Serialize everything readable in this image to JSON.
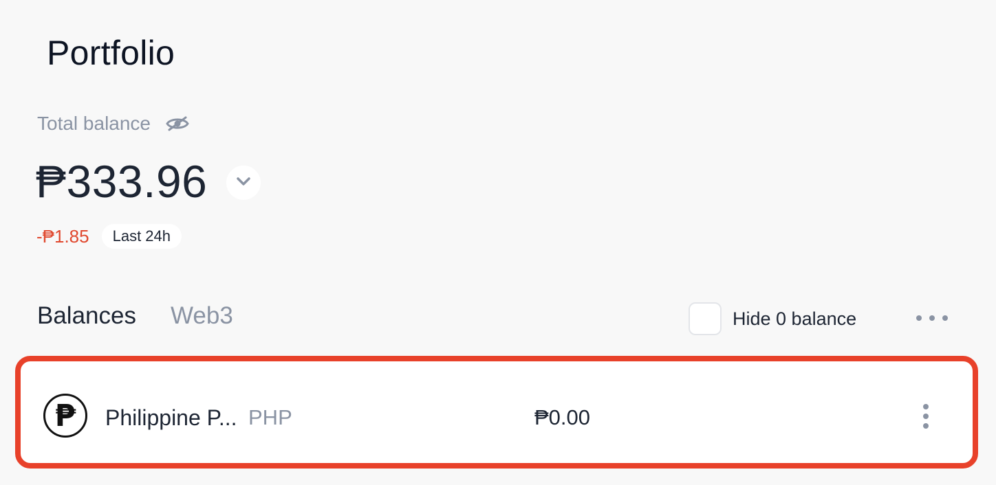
{
  "page": {
    "title": "Portfolio"
  },
  "summary": {
    "total_label": "Total balance",
    "visibility_icon": "eye-hidden-icon",
    "balance": "₱333.96",
    "currency_toggle_icon": "chevron-down-icon",
    "change_value": "-₱1.85",
    "change_period": "Last 24h"
  },
  "tabs": [
    {
      "label": "Balances",
      "active": true
    },
    {
      "label": "Web3",
      "active": false
    }
  ],
  "filters": {
    "hide_zero_label": "Hide 0 balance",
    "hide_zero_checked": false,
    "more_icon": "more-horizontal-icon"
  },
  "assets": [
    {
      "icon_glyph": "₱",
      "name": "Philippine P...",
      "code": "PHP",
      "amount": "₱0.00",
      "more_icon": "more-vertical-icon"
    }
  ],
  "colors": {
    "negative": "#e0482e",
    "highlight_border": "#e8412a",
    "muted_text": "#8a93a3",
    "primary_text": "#1d2533"
  }
}
